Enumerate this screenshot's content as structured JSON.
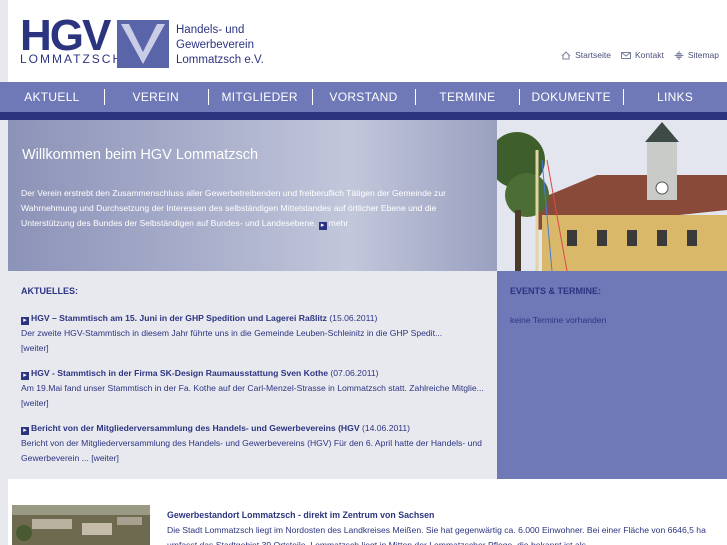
{
  "header": {
    "logo_letters": "HGV",
    "logo_subtitle": "LOMMATZSCH",
    "org_name_lines": [
      "Handels- und",
      "Gewerbeverein",
      "Lommatzsch e.V."
    ]
  },
  "util_nav": [
    {
      "label": "Startseite",
      "icon": "home-icon"
    },
    {
      "label": "Kontakt",
      "icon": "mail-icon"
    },
    {
      "label": "Sitemap",
      "icon": "sitemap-icon"
    }
  ],
  "nav": [
    "AKTUELL",
    "VEREIN",
    "MITGLIEDER",
    "VORSTAND",
    "TERMINE",
    "DOKUMENTE",
    "LINKS"
  ],
  "hero": {
    "title": "Willkommen beim HGV Lommatzsch",
    "text": "Der Verein erstrebt den Zusammenschluss aller Gewerbetreibenden und freiberuflich Tätigen der Gemeinde zur Wahrnehmung und Durchsetzung der Interessen des selbständigen Mittelstandes auf örtlicher Ebene und die Unterstützung des Bundes der Selbständigen auf Bundes- und Landesebene.",
    "more": "mehr"
  },
  "news": {
    "heading": "AKTUELLES:",
    "items": [
      {
        "title": "HGV – Stammtisch am 15. Juni in der GHP Spedition und Lagerei Raßlitz",
        "date": "(15.06.2011)",
        "text": "Der zweite HGV-Stammtisch in diesem Jahr führte uns in die Gemeinde Leuben-Schleinitz in die GHP Spedit...",
        "more": "[weiter]"
      },
      {
        "title": "HGV - Stammtisch in der Firma SK-Design Raumausstattung Sven Kothe",
        "date": "(07.06.2011)",
        "text": "Am 19.Mai fand unser Stammtisch in der Fa. Kothe auf der Carl-Menzel-Strasse in Lommatzsch statt. Zahlreiche Mitglie...",
        "more": "[weiter]"
      },
      {
        "title": "Bericht von der Mitgliederversammlung des Handels- und Gewerbevereins (HGV",
        "date": "(14.06.2011)",
        "text": "Bericht von der Mitgliederversammlung des Handels- und Gewerbevereins (HGV) Für den 6. April hatte der Handels- und Gewerbeverein ...",
        "more": "[weiter]"
      }
    ]
  },
  "events": {
    "heading": "EVENTS & TERMINE:",
    "text": "keine Termine vorhanden"
  },
  "bottom": {
    "title": "Gewerbestandort Lommatzsch - direkt im Zentrum von Sachsen",
    "text": "Die Stadt Lommatzsch liegt im Nordosten des Landkreises Meißen. Sie hat gegenwärtig ca. 6.000 Einwohner. Bei einer Fläche von 6646,5 ha umfasst das Stadtgebiet 39 Ortsteile. Lommatzsch liegt in Mitten der Lommatzscher Pflege, die bekannt ist als"
  },
  "colors": {
    "brand_dark": "#2c3480",
    "nav_bg": "#6f79b8",
    "panel_light": "#e8e9ef"
  }
}
